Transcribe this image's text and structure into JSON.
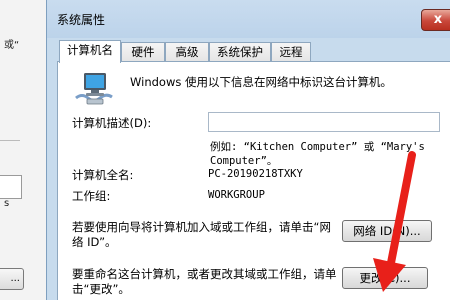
{
  "background": {
    "fragment_1": "或“",
    "fragment_2": "s",
    "button_fragment": "..."
  },
  "dialog": {
    "title": "系统属性",
    "close_symbol": "x",
    "tabs": [
      {
        "label": "计算机名",
        "active": true
      },
      {
        "label": "硬件",
        "active": false
      },
      {
        "label": "高级",
        "active": false
      },
      {
        "label": "系统保护",
        "active": false
      },
      {
        "label": "远程",
        "active": false
      }
    ],
    "intro": "Windows 使用以下信息在网络中标识这台计算机。",
    "description_label": "计算机描述(D):",
    "description_value": "",
    "example_text": "例如: “Kitchen Computer” 或 “Mary's Computer”。",
    "full_name_label": "计算机全名:",
    "full_name_value": "PC-20190218TXKY",
    "workgroup_label": "工作组:",
    "workgroup_value": "WORKGROUP",
    "network_id_text": "若要使用向导将计算机加入域或工作组，请单击“网络 ID”。",
    "network_id_button": "网络 ID(N)...",
    "rename_text": "要重命名这台计算机，或者更改其域或工作组，请单击“更改”。",
    "change_button": "更改(C)..."
  },
  "colors": {
    "annotation_arrow": "#e8201a",
    "titlebar": "#c9dcef",
    "close_button": "#c9473a"
  },
  "icons": [
    "computer-network-icon",
    "close-icon",
    "red-arrow-annotation"
  ]
}
